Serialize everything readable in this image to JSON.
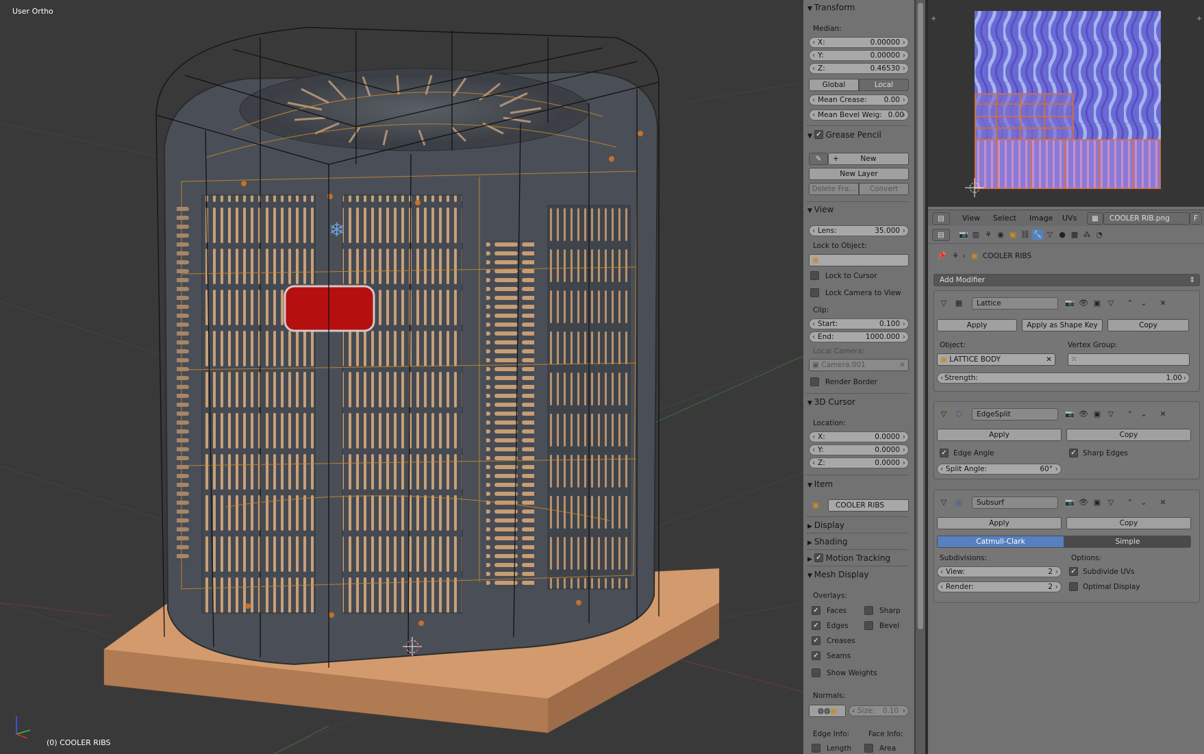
{
  "viewport": {
    "view_name": "User Ortho",
    "object_info": "(0) COOLER RIBS"
  },
  "npanel": {
    "transform": {
      "header": "Transform",
      "median_label": "Median:",
      "x": {
        "label": "X:",
        "value": "0.00000"
      },
      "y": {
        "label": "Y:",
        "value": "0.00000"
      },
      "z": {
        "label": "Z:",
        "value": "0.46530"
      },
      "global_label": "Global",
      "local_label": "Local",
      "mean_crease": {
        "label": "Mean Crease:",
        "value": "0.00"
      },
      "mean_bevel": {
        "label": "Mean Bevel Weig:",
        "value": "0.00"
      }
    },
    "grease_pencil": {
      "header": "Grease Pencil",
      "new_label": "New",
      "new_layer_label": "New Layer",
      "delete_frame_label": "Delete Fra...",
      "convert_label": "Convert"
    },
    "view": {
      "header": "View",
      "lens": {
        "label": "Lens:",
        "value": "35.000"
      },
      "lock_to_object_label": "Lock to Object:",
      "lock_to_cursor_label": "Lock to Cursor",
      "lock_camera_label": "Lock Camera to View",
      "clip_label": "Clip:",
      "clip_start": {
        "label": "Start:",
        "value": "0.100"
      },
      "clip_end": {
        "label": "End:",
        "value": "1000.000"
      },
      "local_camera_label": "Local Camera:",
      "local_camera_value": "Camera.001",
      "render_border_label": "Render Border"
    },
    "cursor": {
      "header": "3D Cursor",
      "location_label": "Location:",
      "x": {
        "label": "X:",
        "value": "0.0000"
      },
      "y": {
        "label": "Y:",
        "value": "0.0000"
      },
      "z": {
        "label": "Z:",
        "value": "0.0000"
      }
    },
    "item": {
      "header": "Item",
      "name": "COOLER RIBS"
    },
    "display_header": "Display",
    "shading_header": "Shading",
    "motion_tracking_header": "Motion Tracking",
    "mesh_display": {
      "header": "Mesh Display",
      "overlays_label": "Overlays:",
      "faces_label": "Faces",
      "sharp_label": "Sharp",
      "edges_label": "Edges",
      "bevel_label": "Bevel",
      "creases_label": "Creases",
      "seams_label": "Seams",
      "show_weights_label": "Show Weights",
      "normals_label": "Normals:",
      "size": {
        "label": "Size:",
        "value": "0.10"
      },
      "edge_info_label": "Edge Info:",
      "face_info_label": "Face Info:",
      "length_label": "Length",
      "area_label": "Area"
    }
  },
  "image_editor": {
    "menus": [
      "View",
      "Select",
      "Image",
      "UVs"
    ],
    "image_name": "COOLER RIB.png",
    "fake_user": "F"
  },
  "properties": {
    "object_name": "COOLER RIBS",
    "add_modifier_label": "Add Modifier",
    "lattice": {
      "name": "Lattice",
      "apply_label": "Apply",
      "apply_shape_label": "Apply as Shape Key",
      "copy_label": "Copy",
      "object_label": "Object:",
      "object_value": "LATTICE BODY",
      "vertex_group_label": "Vertex Group:",
      "strength": {
        "label": "Strength:",
        "value": "1.00"
      }
    },
    "edgesplit": {
      "name": "EdgeSplit",
      "apply_label": "Apply",
      "copy_label": "Copy",
      "edge_angle_label": "Edge Angle",
      "sharp_edges_label": "Sharp Edges",
      "split_angle": {
        "label": "Split Angle:",
        "value": "60°"
      }
    },
    "subsurf": {
      "name": "Subsurf",
      "apply_label": "Apply",
      "copy_label": "Copy",
      "catmull_label": "Catmull-Clark",
      "simple_label": "Simple",
      "subdivisions_label": "Subdivisions:",
      "options_label": "Options:",
      "view": {
        "label": "View:",
        "value": "2"
      },
      "render": {
        "label": "Render:",
        "value": "2"
      },
      "subdivide_uvs_label": "Subdivide UVs",
      "optimal_display_label": "Optimal Display"
    }
  },
  "colors": {
    "selected_accent": "#5680c2",
    "viewport_bg": "#393939",
    "panel_bg": "#727272"
  }
}
